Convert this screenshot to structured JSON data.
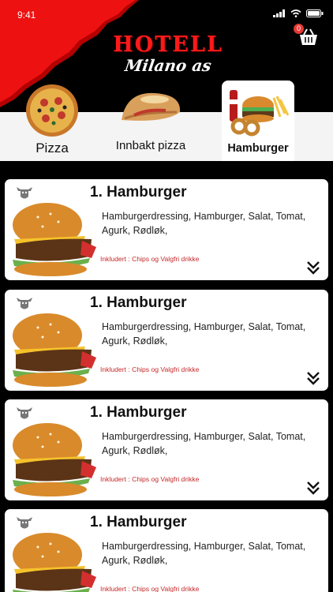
{
  "status_bar": {
    "time": "9:41"
  },
  "brand": {
    "line1": "HOTELL",
    "line2": "Milano as"
  },
  "cart": {
    "count": "0"
  },
  "categories": [
    {
      "label": "Pizza",
      "active": false
    },
    {
      "label": "Innbakt pizza",
      "active": false
    },
    {
      "label": "Hamburger",
      "active": true
    }
  ],
  "items": [
    {
      "title": "1. Hamburger",
      "description": "Hamburgerdressing, Hamburger, Salat, Tomat, Agurk, Rødløk,",
      "included": "Inkludert : Chips og Valgfri drikke"
    },
    {
      "title": "1. Hamburger",
      "description": "Hamburgerdressing, Hamburger, Salat, Tomat, Agurk, Rødløk,",
      "included": "Inkludert : Chips og Valgfri drikke"
    },
    {
      "title": "1. Hamburger",
      "description": "Hamburgerdressing, Hamburger, Salat, Tomat, Agurk, Rødløk,",
      "included": "Inkludert : Chips og Valgfri drikke"
    },
    {
      "title": "1. Hamburger",
      "description": "Hamburgerdressing, Hamburger, Salat, Tomat, Agurk, Rødløk,",
      "included": "Inkludert : Chips og Valgfri drikke"
    }
  ],
  "colors": {
    "brand_red": "#ff1a1a",
    "include_text": "#c62828",
    "background": "#000000"
  },
  "icons": [
    "signal-icon",
    "wifi-icon",
    "battery-icon",
    "cart-icon",
    "cow-icon",
    "double-chevron-down-icon"
  ]
}
